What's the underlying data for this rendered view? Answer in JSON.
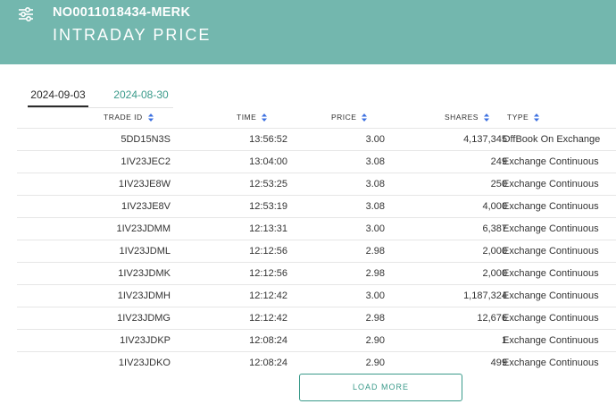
{
  "header": {
    "instrument_id": "NO0011018434-MERK",
    "title": "INTRADAY PRICE",
    "filter_icon": "sliders-icon",
    "background_color": "#73b7ae"
  },
  "tabs": [
    {
      "label": "2024-09-03",
      "active": true
    },
    {
      "label": "2024-08-30",
      "active": false
    }
  ],
  "columns": {
    "trade_id": "TRADE ID",
    "time": "TIME",
    "price": "PRICE",
    "shares": "SHARES",
    "type": "TYPE",
    "sort_icon": "sort-updown-icon"
  },
  "rows": [
    {
      "trade_id": "5DD15N3S",
      "time": "13:56:52",
      "price": "3.00",
      "shares": "4,137,345",
      "type": "OffBook On Exchange"
    },
    {
      "trade_id": "1IV23JEC2",
      "time": "13:04:00",
      "price": "3.08",
      "shares": "249",
      "type": "Exchange Continuous"
    },
    {
      "trade_id": "1IV23JE8W",
      "time": "12:53:25",
      "price": "3.08",
      "shares": "250",
      "type": "Exchange Continuous"
    },
    {
      "trade_id": "1IV23JE8V",
      "time": "12:53:19",
      "price": "3.08",
      "shares": "4,000",
      "type": "Exchange Continuous"
    },
    {
      "trade_id": "1IV23JDMM",
      "time": "12:13:31",
      "price": "3.00",
      "shares": "6,387",
      "type": "Exchange Continuous"
    },
    {
      "trade_id": "1IV23JDML",
      "time": "12:12:56",
      "price": "2.98",
      "shares": "2,000",
      "type": "Exchange Continuous"
    },
    {
      "trade_id": "1IV23JDMK",
      "time": "12:12:56",
      "price": "2.98",
      "shares": "2,000",
      "type": "Exchange Continuous"
    },
    {
      "trade_id": "1IV23JDMH",
      "time": "12:12:42",
      "price": "3.00",
      "shares": "1,187,324",
      "type": "Exchange Continuous"
    },
    {
      "trade_id": "1IV23JDMG",
      "time": "12:12:42",
      "price": "2.98",
      "shares": "12,676",
      "type": "Exchange Continuous"
    },
    {
      "trade_id": "1IV23JDKP",
      "time": "12:08:24",
      "price": "2.90",
      "shares": "1",
      "type": "Exchange Continuous"
    },
    {
      "trade_id": "1IV23JDKO",
      "time": "12:08:24",
      "price": "2.90",
      "shares": "499",
      "type": "Exchange Continuous"
    }
  ],
  "load_more": {
    "label": "LOAD MORE"
  },
  "colors": {
    "accent": "#3a9a8a",
    "sort_arrow": "#3b6fe0"
  }
}
